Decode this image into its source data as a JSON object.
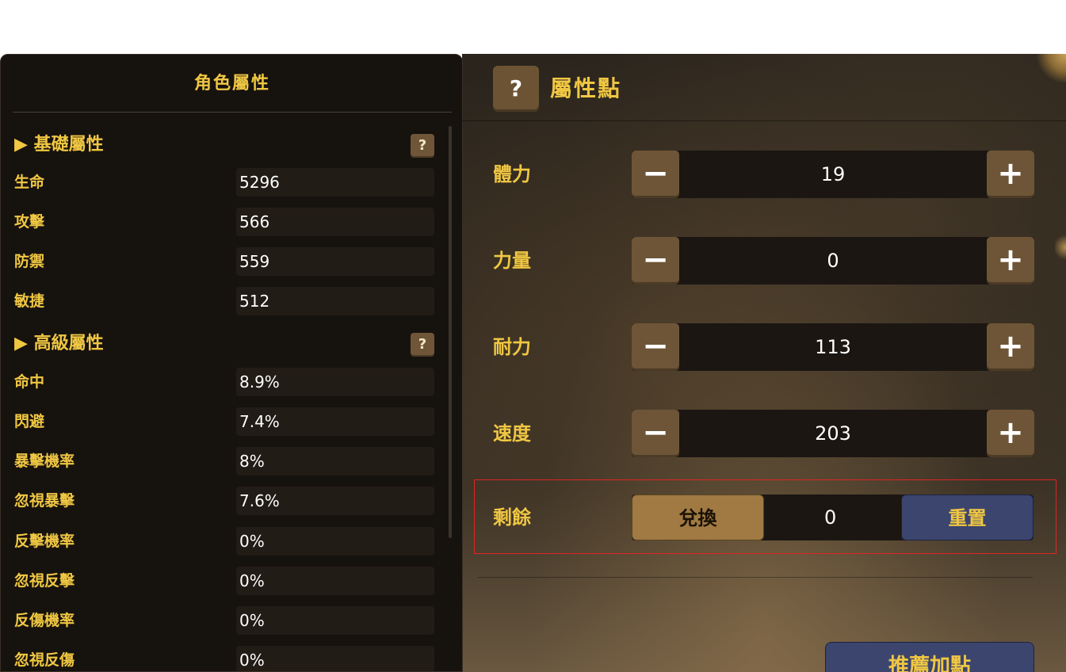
{
  "character_panel": {
    "title": "角色屬性",
    "basic": {
      "header": "▶ 基礎屬性",
      "help": "?",
      "rows": [
        {
          "label": "生命",
          "value": "5296"
        },
        {
          "label": "攻擊",
          "value": "566"
        },
        {
          "label": "防禦",
          "value": "559"
        },
        {
          "label": "敏捷",
          "value": "512"
        }
      ]
    },
    "advanced": {
      "header": "▶ 高級屬性",
      "help": "?",
      "rows": [
        {
          "label": "命中",
          "value": "8.9%"
        },
        {
          "label": "閃避",
          "value": "7.4%"
        },
        {
          "label": "暴擊機率",
          "value": "8%"
        },
        {
          "label": "忽視暴擊",
          "value": "7.6%"
        },
        {
          "label": "反擊機率",
          "value": "0%"
        },
        {
          "label": "忽視反擊",
          "value": "0%"
        },
        {
          "label": "反傷機率",
          "value": "0%"
        },
        {
          "label": "忽視反傷",
          "value": "0%"
        }
      ]
    }
  },
  "points_panel": {
    "help": "?",
    "title": "屬性點",
    "minus": "−",
    "plus": "+",
    "stats": [
      {
        "label": "體力",
        "value": "19"
      },
      {
        "label": "力量",
        "value": "0"
      },
      {
        "label": "耐力",
        "value": "113"
      },
      {
        "label": "速度",
        "value": "203"
      }
    ],
    "remaining": {
      "label": "剩餘",
      "exchange": "兌換",
      "value": "0",
      "reset": "重置"
    },
    "recommend": "推薦加點"
  },
  "colors": {
    "accent_gold": "#f0c742",
    "button_brown": "#6e5537",
    "button_blue": "#3c456e",
    "highlight_red": "#e02424"
  }
}
